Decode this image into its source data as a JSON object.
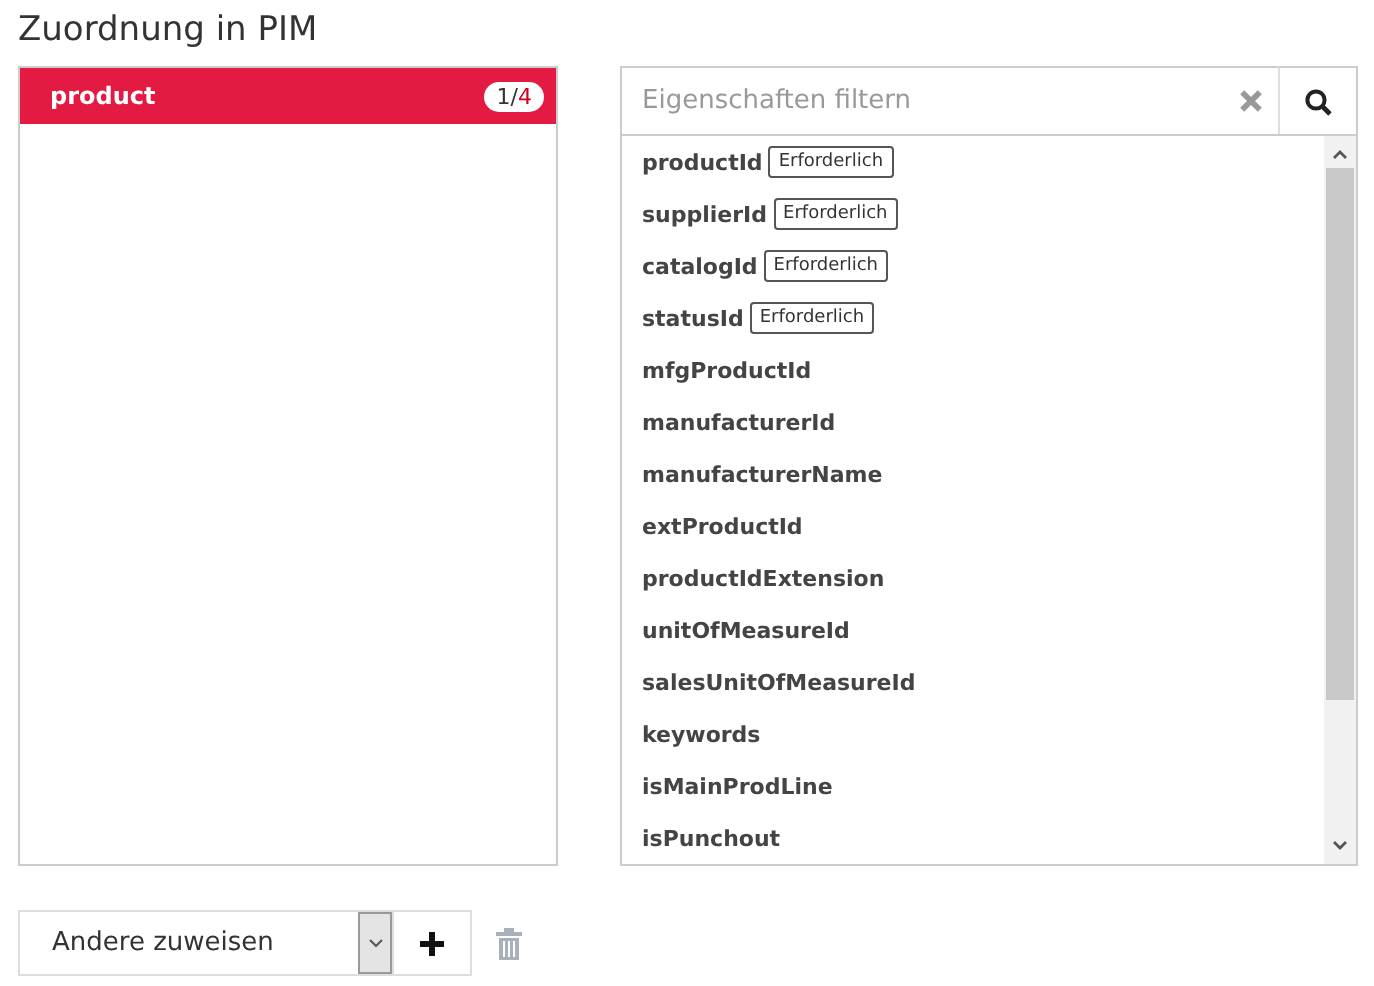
{
  "title": "Zuordnung in PIM",
  "mapping": {
    "items": [
      {
        "label": "product",
        "selected": true,
        "count": "1/",
        "total": "4"
      }
    ]
  },
  "filter": {
    "placeholder": "Eigenschaften filtern"
  },
  "properties": [
    {
      "name": "productId",
      "tag": "Erforderlich"
    },
    {
      "name": "supplierId",
      "tag": "Erforderlich"
    },
    {
      "name": "catalogId",
      "tag": "Erforderlich"
    },
    {
      "name": "statusId",
      "tag": "Erforderlich"
    },
    {
      "name": "mfgProductId"
    },
    {
      "name": "manufacturerId"
    },
    {
      "name": "manufacturerName"
    },
    {
      "name": "extProductId"
    },
    {
      "name": "productIdExtension"
    },
    {
      "name": "unitOfMeasureId"
    },
    {
      "name": "salesUnitOfMeasureId"
    },
    {
      "name": "keywords"
    },
    {
      "name": "isMainProdLine"
    },
    {
      "name": "isPunchout"
    }
  ],
  "assign": {
    "value": "Andere zuweisen"
  }
}
